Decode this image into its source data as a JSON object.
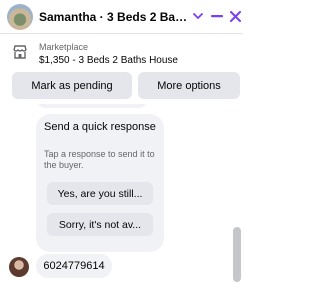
{
  "header": {
    "title": "Samantha · 3 Beds 2 Baths...",
    "avatar_icon": "house-photo-avatar",
    "buttons": [
      "chevron-down-icon",
      "minimize-icon",
      "close-icon"
    ],
    "accent_color": "#7b3ff2"
  },
  "listing": {
    "source_label": "Marketplace",
    "title": "$1,350 - 3 Beds 2 Baths House",
    "icon": "shop-icon",
    "mark_pending_label": "Mark as pending",
    "more_options_label": "More options"
  },
  "quick_response": {
    "title": "Send a quick response",
    "subtitle": "Tap a response to send it to the buyer.",
    "options": [
      "Yes, are you still...",
      "Sorry, it's not av..."
    ]
  },
  "messages": [
    {
      "sender_avatar": "buyer-avatar",
      "text": "6024779614"
    }
  ]
}
